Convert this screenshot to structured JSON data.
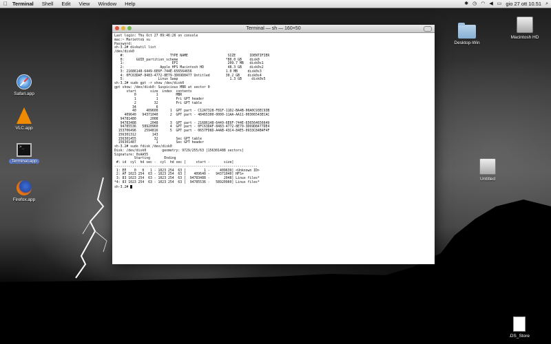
{
  "menubar": {
    "apple": "",
    "app_name": "Terminal",
    "items": [
      "Shell",
      "Edit",
      "View",
      "Window",
      "Help"
    ],
    "datetime": "gio 27 ott  10.51",
    "search_icon": "⌕"
  },
  "desktop": {
    "icons": {
      "safari": "Safari.app",
      "vlc": "VLC.app",
      "terminal": "Terminal.app",
      "firefox": "Firefox.app",
      "desktop_win": "Desktop-Win",
      "macintosh_hd": "Macintosh HD",
      "untitled": "Untitled",
      "ds_store": ".DS_Store"
    }
  },
  "terminal": {
    "title": "Terminal — sh — 160×50",
    "lines": [
      "Last login: Thu Oct 27 09:46:26 on console",
      "mac:~ Marietto$ su",
      "Password:",
      "sh-3.2# diskutil list",
      "/dev/disk0",
      "   #:                       TYPE NAME                    SIZE       IDENTIFIER",
      "   0:      GUID_partition_scheme                        *80.0 GB    disk0",
      "   1:                        EFI                         209.7 MB   disk0s1",
      "   2:                  Apple_HFS Macintosh HD            48.3 GB    disk0s2",
      "   3: 21686148-6449-6E6F-744E-656564656                 1.0 MB     disk0s3",
      "   4: 0FC63DAF-8483-4772-8E79-3D69D8477 Untitled        30.2 GB    disk0s4",
      "   5:                 Linux Swap                          1.3 GB     disk0s5",
      "sh-3.2# sudo gpt -r show /dev/disk0",
      "gpt show: /dev/disk0: Suspicious MBR at sector 0",
      "      start       size  index  contents",
      "          0          1         MBR",
      "          1          1         Pri GPT header",
      "          2         32         Pri GPT table",
      "         34          6",
      "         40     409600      1  GPT part - C12A7328-F81F-11D2-BA4B-00A0C93EC93B",
      "     409640   94371040      2  GPT part - 48465300-0000-11AA-AA11-00306543ECAC",
      "   94781480       2008",
      "   94783488       2048      3  GPT part - 21686148-6449-6E6F-744E-656564656649",
      "   94785536   58920960      4  GPT part - 0FC63DAF-8483-4772-8E79-3D69D8477DE4",
      "  153706496    2594816      5  GPT part - 0657FD6D-A4AB-43C4-84E5-0933C84B4F4F",
      "  156301312        143",
      "  156301455         32         Sec GPT table",
      "  156301487          1         Sec GPT header",
      "sh-3.2# sudo fdisk /dev/disk0",
      "Disk: /dev/disk0        geometry: 9729/255/63 [156301488 sectors]",
      "Signature: 0xAA55",
      "          Starting       Ending",
      " #: id  cyl  hd sec -  cyl  hd sec [     start -       size]",
      "------------------------------------------------------------------------",
      " 1: EE    0   0   1 - 1023 254  63 [         1 -     409639] <Unknown ID>",
      " 2: AF 1023 254  63 - 1023 254  63 [    409640 -   94371040] HFS+",
      " 3: 83 1023 254  63 - 1023 254  63 [  94783488 -       2048] Linux files*",
      "*4: 83 1023 254  63 - 1023 254  63 [  94785536 -   58920960] Linux files*",
      "sh-3.2# "
    ]
  }
}
